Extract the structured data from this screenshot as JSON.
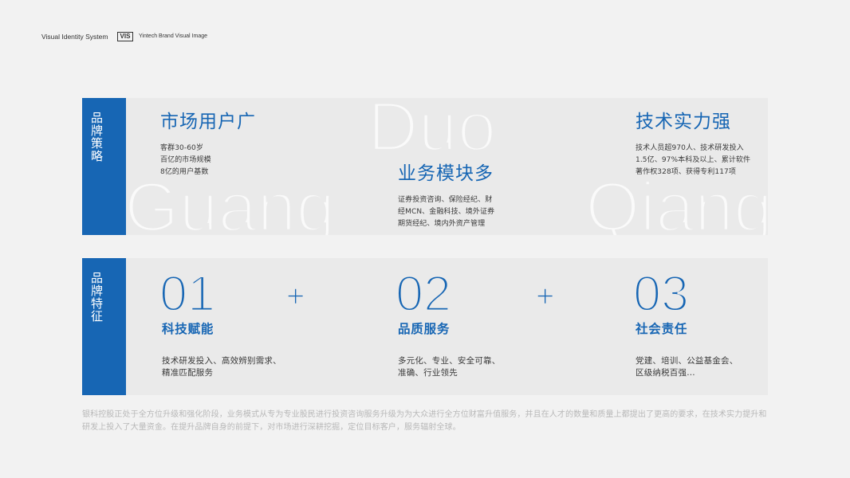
{
  "header": {
    "title": "Visual Identity System",
    "badge": "VIS",
    "subtitle": "Yintech Brand Visual Image"
  },
  "strategy": {
    "label": "品牌策略",
    "columns": [
      {
        "watermark": "Guang",
        "title": "市场用户广",
        "lines": [
          "客群30-60岁",
          "百亿的市场规模",
          "8亿的用户基数"
        ]
      },
      {
        "watermark": "Duo",
        "title": "业务模块多",
        "lines": [
          "证券投资咨询、保险经纪、财",
          "经MCN、金融科技、境外证券",
          "期货经纪、境内外资产管理"
        ]
      },
      {
        "watermark": "Qiang",
        "title": "技术实力强",
        "lines": [
          "技术人员超970人、技术研发投入",
          "1.5亿、97%本科及以上、累计软件",
          "著作权328项、获得专利117项"
        ]
      }
    ]
  },
  "features": {
    "label": "品牌特征",
    "items": [
      {
        "number": "01",
        "title": "科技赋能",
        "lines": [
          "技术研发投入、高效辨别需求、",
          "精准匹配服务"
        ]
      },
      {
        "number": "02",
        "title": "品质服务",
        "lines": [
          "多元化、专业、安全可靠、",
          "准确、行业领先"
        ]
      },
      {
        "number": "03",
        "title": "社会责任",
        "lines": [
          "党建、培训、公益基金会、",
          "区级纳税百强..."
        ]
      }
    ],
    "separators": [
      "+",
      "+"
    ]
  },
  "footer": {
    "lines": [
      "银科控股正处于全方位升级和强化阶段，业务模式从专为专业股民进行投资咨询服务升级为为大众进行全方位财富升值服务，并且在人才的数量和质量上都提出了更高的要求，在技术实力提升和",
      "研发上投入了大量资金。在提升品牌自身的前提下，对市场进行深耕挖掘，定位目标客户，服务辐射全球。"
    ]
  },
  "colors": {
    "page": "#f2f2f2",
    "panel": "#eaeaea",
    "accent": "#1766b4",
    "body_text": "#3a3a3a",
    "muted_text": "#b8b8b8",
    "watermark": "#fafafa",
    "header_text": "#333333"
  }
}
